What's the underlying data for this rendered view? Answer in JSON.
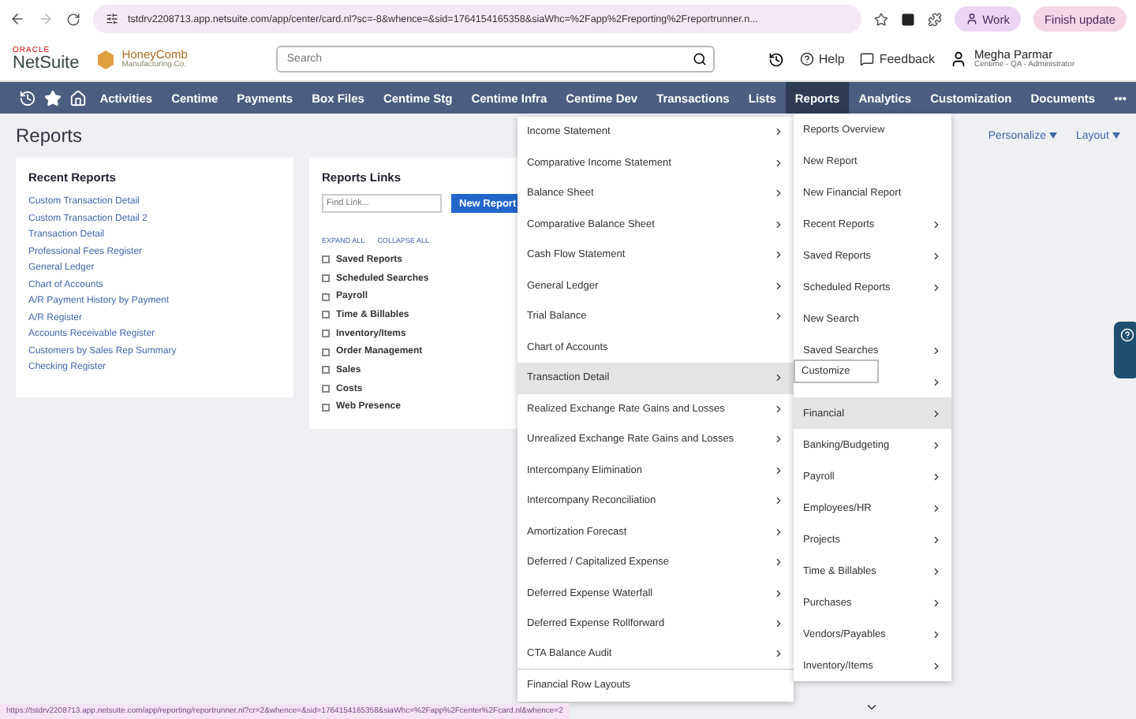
{
  "browser": {
    "url": "tstdrv2208713.app.netsuite.com/app/center/card.nl?sc=-8&whence=&sid=1764154165358&siaWhc=%2Fapp%2Freporting%2Freportrunner.n...",
    "profile": "Work",
    "update": "Finish update"
  },
  "header": {
    "brand_small": "ORACLE",
    "brand": "NetSuite",
    "company": "HoneyComb",
    "company_sub": "Manufacturing Co.",
    "search_placeholder": "Search",
    "help": "Help",
    "feedback": "Feedback",
    "user_name": "Megha Parmar",
    "user_role": "Centime - QA - Administrator"
  },
  "nav": {
    "items": [
      {
        "label": "Activities",
        "selected": false
      },
      {
        "label": "Centime",
        "selected": false
      },
      {
        "label": "Payments",
        "selected": false
      },
      {
        "label": "Box Files",
        "selected": false
      },
      {
        "label": "Centime Stg",
        "selected": false
      },
      {
        "label": "Centime Infra",
        "selected": false
      },
      {
        "label": "Centime Dev",
        "selected": false
      },
      {
        "label": "Transactions",
        "selected": false
      },
      {
        "label": "Lists",
        "selected": false
      },
      {
        "label": "Reports",
        "selected": true
      },
      {
        "label": "Analytics",
        "selected": false
      },
      {
        "label": "Customization",
        "selected": false
      },
      {
        "label": "Documents",
        "selected": false
      }
    ],
    "more": "•••"
  },
  "page": {
    "title": "Reports",
    "personalize": "Personalize",
    "layout": "Layout"
  },
  "recent_reports": {
    "title": "Recent Reports",
    "links": [
      "Custom Transaction Detail",
      "Custom Transaction Detail 2",
      "Transaction Detail",
      "Professional Fees Register",
      "General Ledger",
      "Chart of Accounts",
      "A/R Payment History by Payment",
      "A/R Register",
      "Accounts Receivable Register",
      "Customers by Sales Rep Summary",
      "Checking Register"
    ]
  },
  "report_links": {
    "title": "Reports Links",
    "find_placeholder": "Find Link...",
    "new_report": "New Report",
    "expand_all": "EXPAND ALL",
    "collapse_all": "COLLAPSE ALL",
    "sections": [
      {
        "label": "Saved Reports",
        "expanded": false
      },
      {
        "label": "Scheduled Searches",
        "expanded": false
      },
      {
        "label": "Payroll",
        "expanded": false
      },
      {
        "label": "Time & Billables",
        "expanded": false
      },
      {
        "label": "Inventory/Items",
        "expanded": false
      },
      {
        "label": "Order Management",
        "expanded": false
      },
      {
        "label": "Sales",
        "expanded": false
      },
      {
        "label": "Costs",
        "expanded": false
      },
      {
        "label": "Web Presence",
        "expanded": false
      }
    ]
  },
  "financial_menu": {
    "items": [
      {
        "label": "Income Statement",
        "submenu": true,
        "selected": false
      },
      {
        "label": "Comparative Income Statement",
        "submenu": true,
        "selected": false
      },
      {
        "label": "Balance Sheet",
        "submenu": true,
        "selected": false
      },
      {
        "label": "Comparative Balance Sheet",
        "submenu": true,
        "selected": false
      },
      {
        "label": "Cash Flow Statement",
        "submenu": true,
        "selected": false
      },
      {
        "label": "General Ledger",
        "submenu": true,
        "selected": false
      },
      {
        "label": "Trial Balance",
        "submenu": true,
        "selected": false
      },
      {
        "label": "Chart of Accounts",
        "submenu": false,
        "selected": false
      },
      {
        "label": "Transaction Detail",
        "submenu": true,
        "selected": true
      },
      {
        "label": "Realized Exchange Rate Gains and Losses",
        "submenu": true,
        "selected": false
      },
      {
        "label": "Unrealized Exchange Rate Gains and Losses",
        "submenu": true,
        "selected": false
      },
      {
        "label": "Intercompany Elimination",
        "submenu": true,
        "selected": false
      },
      {
        "label": "Intercompany Reconciliation",
        "submenu": true,
        "selected": false
      },
      {
        "label": "Amortization Forecast",
        "submenu": true,
        "selected": false
      },
      {
        "label": "Deferred / Capitalized Expense",
        "submenu": true,
        "selected": false
      },
      {
        "label": "Deferred Expense Waterfall",
        "submenu": true,
        "selected": false
      },
      {
        "label": "Deferred Expense Rollforward",
        "submenu": true,
        "selected": false
      },
      {
        "label": "CTA Balance Audit",
        "submenu": true,
        "selected": false
      },
      {
        "label": "Financial Row Layouts",
        "submenu": false,
        "selected": false
      }
    ]
  },
  "reports_menu": {
    "customize_tooltip": "Customize",
    "items": [
      {
        "label": "Reports Overview",
        "submenu": false,
        "selected": false
      },
      {
        "label": "New Report",
        "submenu": false,
        "selected": false
      },
      {
        "label": "New Financial Report",
        "submenu": false,
        "selected": false
      },
      {
        "label": "Recent Reports",
        "submenu": true,
        "selected": false
      },
      {
        "label": "Saved Reports",
        "submenu": true,
        "selected": false
      },
      {
        "label": "Scheduled Reports",
        "submenu": true,
        "selected": false
      },
      {
        "label": "New Search",
        "submenu": false,
        "selected": false
      },
      {
        "label": "Saved Searches",
        "submenu": true,
        "selected": false
      },
      {
        "submenu": true,
        "selected": false
      },
      {
        "label": "Financial",
        "submenu": true,
        "selected": true
      },
      {
        "label": "Banking/Budgeting",
        "submenu": true,
        "selected": false
      },
      {
        "label": "Payroll",
        "submenu": true,
        "selected": false
      },
      {
        "label": "Employees/HR",
        "submenu": true,
        "selected": false
      },
      {
        "label": "Projects",
        "submenu": true,
        "selected": false
      },
      {
        "label": "Time & Billables",
        "submenu": true,
        "selected": false
      },
      {
        "label": "Purchases",
        "submenu": true,
        "selected": false
      },
      {
        "label": "Vendors/Payables",
        "submenu": true,
        "selected": false
      },
      {
        "label": "Inventory/Items",
        "submenu": true,
        "selected": false
      }
    ]
  },
  "status_url": "https://tstdrv2208713.app.netsuite.com/app/reporting/reportrunner.nl?cr=2&whence=&sid=1764154165358&siaWhc=%2Fapp%2Fcenter%2Fcard.nl&whence=2"
}
